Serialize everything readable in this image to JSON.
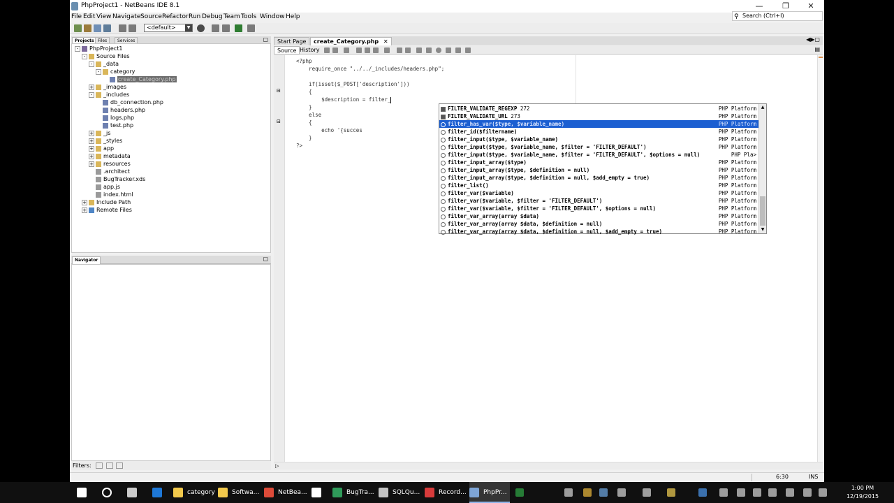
{
  "window": {
    "title": "PhpProject1 - NetBeans IDE 8.1"
  },
  "menu": [
    "File",
    "Edit",
    "View",
    "Navigate",
    "Source",
    "Refactor",
    "Run",
    "Debug",
    "Team",
    "Tools",
    "Window",
    "Help"
  ],
  "search": {
    "placeholder": "Search (Ctrl+I)"
  },
  "toolbar": {
    "config": "<default>"
  },
  "left_tabs": [
    "Projects",
    "Files",
    "Services"
  ],
  "tree": [
    {
      "label": "PhpProject1",
      "depth": 0,
      "exp": "-",
      "icon": "project-icon"
    },
    {
      "label": "Source Files",
      "depth": 1,
      "exp": "-",
      "icon": "folder-icon"
    },
    {
      "label": "_data",
      "depth": 2,
      "exp": "-",
      "icon": "folder-icon"
    },
    {
      "label": "category",
      "depth": 3,
      "exp": "-",
      "icon": "folder-icon"
    },
    {
      "label": "create_Category.php",
      "depth": 4,
      "exp": "",
      "icon": "php-file-icon",
      "selected": true
    },
    {
      "label": "_images",
      "depth": 2,
      "exp": "+",
      "icon": "folder-icon"
    },
    {
      "label": "_includes",
      "depth": 2,
      "exp": "-",
      "icon": "folder-icon"
    },
    {
      "label": "db_connection.php",
      "depth": 3,
      "exp": "",
      "icon": "php-file-icon"
    },
    {
      "label": "headers.php",
      "depth": 3,
      "exp": "",
      "icon": "php-file-icon"
    },
    {
      "label": "logs.php",
      "depth": 3,
      "exp": "",
      "icon": "php-file-icon"
    },
    {
      "label": "test.php",
      "depth": 3,
      "exp": "",
      "icon": "php-file-icon"
    },
    {
      "label": "_js",
      "depth": 2,
      "exp": "+",
      "icon": "folder-icon"
    },
    {
      "label": "_styles",
      "depth": 2,
      "exp": "+",
      "icon": "folder-icon"
    },
    {
      "label": "app",
      "depth": 2,
      "exp": "+",
      "icon": "folder-icon"
    },
    {
      "label": "metadata",
      "depth": 2,
      "exp": "+",
      "icon": "folder-icon"
    },
    {
      "label": "resources",
      "depth": 2,
      "exp": "+",
      "icon": "folder-icon"
    },
    {
      "label": ".architect",
      "depth": 2,
      "exp": "",
      "icon": "file-icon"
    },
    {
      "label": "BugTracker.xds",
      "depth": 2,
      "exp": "",
      "icon": "file-icon"
    },
    {
      "label": "app.js",
      "depth": 2,
      "exp": "",
      "icon": "file-icon"
    },
    {
      "label": "index.html",
      "depth": 2,
      "exp": "",
      "icon": "file-icon"
    },
    {
      "label": "Include Path",
      "depth": 1,
      "exp": "+",
      "icon": "folder-icon"
    },
    {
      "label": "Remote Files",
      "depth": 1,
      "exp": "+",
      "icon": "globe-icon"
    }
  ],
  "navigator": {
    "title": "Navigator"
  },
  "filters": {
    "label": "Filters:"
  },
  "editor_tabs": [
    "Start Page",
    "create_Category.php"
  ],
  "editor_modes": [
    "Source",
    "History"
  ],
  "code": [
    "<?php",
    "    require_once \"../../_includes/headers.php\";",
    "",
    "    if(isset($_POST['description']))",
    "    {",
    "        $description = filter_",
    "    }",
    "    else",
    "    {",
    "        echo '{succes",
    "    }",
    "?>"
  ],
  "completion": {
    "items": [
      {
        "name": "FILTER_VALIDATE_REGEXP",
        "extra": " 272",
        "source": "PHP Platform",
        "kind": "const"
      },
      {
        "name": "FILTER_VALIDATE_URL",
        "extra": " 273",
        "source": "PHP Platform",
        "kind": "const"
      },
      {
        "name": "filter_has_var($type, $variable_name)",
        "extra": "",
        "source": "PHP Platform",
        "kind": "fn",
        "selected": true
      },
      {
        "name": "filter_id($filtername)",
        "extra": "",
        "source": "PHP Platform",
        "kind": "fn"
      },
      {
        "name": "filter_input($type, $variable_name)",
        "extra": "",
        "source": "PHP Platform",
        "kind": "fn"
      },
      {
        "name": "filter_input($type, $variable_name, $filter = 'FILTER_DEFAULT')",
        "extra": "",
        "source": "PHP Platform",
        "kind": "fn"
      },
      {
        "name": "filter_input($type, $variable_name, $filter = 'FILTER_DEFAULT', $options = null)",
        "extra": "",
        "source": "PHP Pla>",
        "kind": "fn"
      },
      {
        "name": "filter_input_array($type)",
        "extra": "",
        "source": "PHP Platform",
        "kind": "fn"
      },
      {
        "name": "filter_input_array($type, $definition = null)",
        "extra": "",
        "source": "PHP Platform",
        "kind": "fn"
      },
      {
        "name": "filter_input_array($type, $definition = null, $add_empty = true)",
        "extra": "",
        "source": "PHP Platform",
        "kind": "fn"
      },
      {
        "name": "filter_list()",
        "extra": "",
        "source": "PHP Platform",
        "kind": "fn"
      },
      {
        "name": "filter_var($variable)",
        "extra": "",
        "source": "PHP Platform",
        "kind": "fn"
      },
      {
        "name": "filter_var($variable, $filter = 'FILTER_DEFAULT')",
        "extra": "",
        "source": "PHP Platform",
        "kind": "fn"
      },
      {
        "name": "filter_var($variable, $filter = 'FILTER_DEFAULT', $options = null)",
        "extra": "",
        "source": "PHP Platform",
        "kind": "fn"
      },
      {
        "name": "filter_var_array(array $data)",
        "extra": "",
        "source": "PHP Platform",
        "kind": "fn"
      },
      {
        "name": "filter_var_array(array $data, $definition = null)",
        "extra": "",
        "source": "PHP Platform",
        "kind": "fn"
      },
      {
        "name": "filter_var_array(array $data, $definition = null, $add_empty = true)",
        "extra": "",
        "source": "PHP Platform",
        "kind": "fn"
      }
    ]
  },
  "status": {
    "position": "6:30",
    "mode": "INS"
  },
  "taskbar": [
    {
      "label": "",
      "icon": "windows-start-icon",
      "color": "#ffffff"
    },
    {
      "label": "",
      "icon": "cortana-icon",
      "color": "#ffffff"
    },
    {
      "label": "",
      "icon": "task-view-icon",
      "color": "#cccccc"
    },
    {
      "label": "",
      "icon": "edge-icon",
      "color": "#1e78d7"
    },
    {
      "label": "category",
      "icon": "folder-icon",
      "color": "#f2c94c"
    },
    {
      "label": "Softwa...",
      "icon": "folder-icon",
      "color": "#f2c94c"
    },
    {
      "label": "NetBea...",
      "icon": "chrome-icon",
      "color": "#dd4b39"
    },
    {
      "label": "",
      "icon": "store-icon",
      "color": "#ffffff"
    },
    {
      "label": "BugTra...",
      "icon": "app-icon",
      "color": "#2f9b5a"
    },
    {
      "label": "SQLQu...",
      "icon": "sql-icon",
      "color": "#c3c3c3"
    },
    {
      "label": "Record...",
      "icon": "record-icon",
      "color": "#d83b3b"
    },
    {
      "label": "PhpPr...",
      "icon": "netbeans-icon",
      "color": "#7ea5d6"
    }
  ],
  "clock": {
    "time": "1:00 PM",
    "date": "12/19/2015"
  }
}
